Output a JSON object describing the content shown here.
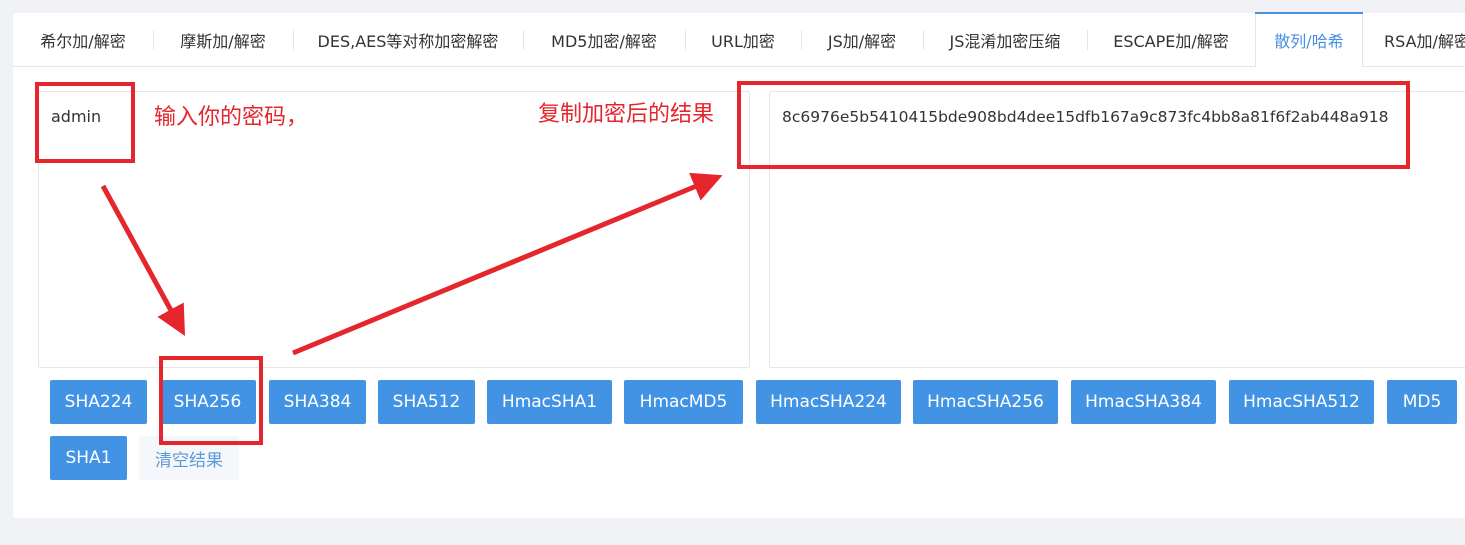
{
  "tabs": [
    {
      "label": "希尔加/解密",
      "active": false
    },
    {
      "label": "摩斯加/解密",
      "active": false
    },
    {
      "label": "DES,AES等对称加密解密",
      "active": false
    },
    {
      "label": "MD5加密/解密",
      "active": false
    },
    {
      "label": "URL加密",
      "active": false
    },
    {
      "label": "JS加/解密",
      "active": false
    },
    {
      "label": "JS混淆加密压缩",
      "active": false
    },
    {
      "label": "ESCAPE加/解密",
      "active": false
    },
    {
      "label": "散列/哈希",
      "active": true
    },
    {
      "label": "RSA加/解密",
      "active": false
    }
  ],
  "input": {
    "value": "admin"
  },
  "output": {
    "value": "8c6976e5b5410415bde908bd4dee15dfb167a9c873fc4bb8a81f6f2ab448a918"
  },
  "buttons": [
    "SHA224",
    "SHA256",
    "SHA384",
    "SHA512",
    "HmacSHA1",
    "HmacMD5",
    "HmacSHA224",
    "HmacSHA256",
    "HmacSHA384",
    "HmacSHA512",
    "MD5",
    "SHA1"
  ],
  "clear_label": "清空结果",
  "annotations": {
    "input_note": "输入你的密码，",
    "output_note": "复制加密后的结果",
    "color": "#e5262d"
  },
  "colors": {
    "accent": "#4a90e2",
    "button": "#4293e4"
  }
}
